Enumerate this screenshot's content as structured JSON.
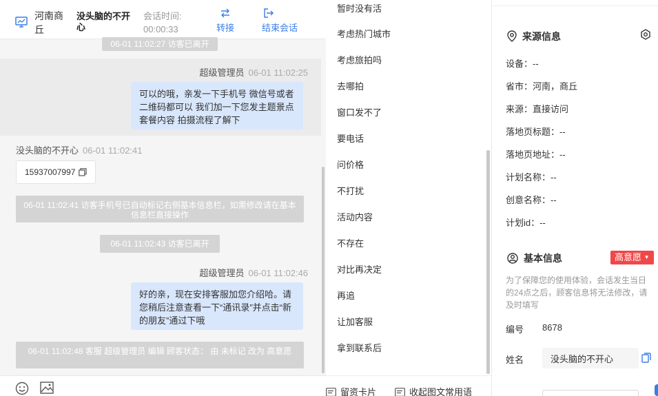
{
  "header": {
    "region": "河南商丘",
    "visitor_name": "没头脑的不开心",
    "session_time_label": "会话时间:",
    "session_time_value": "00:00:33",
    "transfer_label": "转接",
    "end_session_label": "结束会话"
  },
  "messages": {
    "sys1": "06-01 11:02:27 访客已离开",
    "agent1_sender": "超级管理员",
    "agent1_time": "06-01 11:02:25",
    "agent1_text": "可以的哦，亲发一下手机号 微信号或者二维码都可以 我们加一下您发主题景点套餐内容 拍摄流程了解下",
    "visitor1_sender": "没头脑的不开心",
    "visitor1_time": "06-01 11:02:41",
    "visitor1_phone": "15937007997",
    "sys2": "06-01 11:02:41 访客手机号已自动标记右侧基本信息栏，如需修改请在基本信息栏直接操作",
    "sys3": "06-01 11:02:43 访客已离开",
    "agent2_sender": "超级管理员",
    "agent2_time": "06-01 11:02:46",
    "agent2_text": "好的亲，现在安排客服加您介绍哈。请您稍后注意查看一下“通讯录”并点击“新的朋友”通过下哦",
    "sys4": "06-01 11:02:48 客服 超级管理员 编辑 顾客状态： 由 未标记 改为 高意愿"
  },
  "chat_tools": {
    "emoji_icon": "smiley-icon",
    "image_icon": "image-icon"
  },
  "quick_replies": {
    "items": [
      "暂时没有活",
      "考虑热门城市",
      "考虑旅拍吗",
      "去哪拍",
      "窗口发不了",
      "要电话",
      "问价格",
      "不打扰",
      "活动内容",
      "不存在",
      "对比再决定",
      "再追",
      "让加客服",
      "拿到联系后"
    ],
    "leave_card": "留资卡片",
    "collapse_phrases": "收起图文常用语"
  },
  "source_info": {
    "title": "来源信息",
    "device": "设备：--",
    "province_city": "省市：河南，商丘",
    "source": "来源：直接访问",
    "landing_title": "落地页标题：--",
    "landing_url": "落地页地址：--",
    "plan_name": "计划名称：--",
    "creative_name": "创意名称：--",
    "plan_id": "计划id：--"
  },
  "basic_info": {
    "title": "基本信息",
    "intent_badge": "高意愿",
    "notice": "为了保障您的使用体验，会话发生当日的24点之后，顾客信息将无法修改，请及时填写",
    "number_label": "编号",
    "number_value": "8678",
    "name_label": "姓名",
    "name_value": "没头脑的不开心"
  },
  "colors": {
    "accent": "#3a7ee8",
    "badge_red": "#f04848",
    "bubble_blue": "#d9e7fc",
    "system_gray": "#d4d4d4"
  }
}
